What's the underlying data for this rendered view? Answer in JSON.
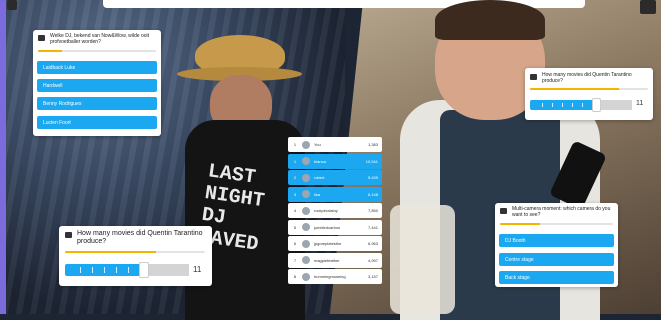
{
  "card_wide": {
    "question": "Welke DJ, bekend van Now&Wow, wilde ooit profvoetballer worden?",
    "progress": 0.2,
    "options": [
      "Laidback Luke",
      "Hardwell",
      "Benny Rodrigues",
      "Lucien Foort"
    ]
  },
  "card_slider_left": {
    "question": "How many movies did Quentin Tarantino produce?",
    "progress": 0.65,
    "value": "11"
  },
  "card_slider_right": {
    "question": "How many movies did Quentin Tarantino produce?",
    "progress": 0.75,
    "value": "11"
  },
  "card_multicam": {
    "question": "Multi-camera moment: which camera do you want to see?",
    "progress": 0.35,
    "options": [
      "DJ Booth",
      "Centre stage",
      "Back stage"
    ]
  },
  "leaderboard": {
    "rows": [
      {
        "rank": "1",
        "name": "You",
        "score": "1,383",
        "style": "white"
      },
      {
        "rank": "1",
        "name": "bianca",
        "score": "10,541",
        "style": "blue"
      },
      {
        "rank": "2",
        "name": "robert",
        "score": "9,439",
        "style": "blue"
      },
      {
        "rank": "3",
        "name": "lisa",
        "score": "8,148",
        "style": "blue"
      },
      {
        "rank": "4",
        "name": "rockperalainy",
        "score": "7,850",
        "style": "white"
      },
      {
        "rank": "5",
        "name": "jumbledcarbon",
        "score": "7,441",
        "style": "white"
      },
      {
        "rank": "6",
        "name": "jpgoreplatesthe",
        "score": "6,963",
        "style": "white"
      },
      {
        "rank": "7",
        "name": "magpiefeather",
        "score": "4,997",
        "style": "white"
      },
      {
        "rank": "8",
        "name": "hummingmuseing",
        "score": "3,157",
        "style": "white"
      }
    ]
  },
  "colors": {
    "accent": "#1ba8f0",
    "progress": "#f5b400",
    "stripe": "#7b6bdc"
  }
}
